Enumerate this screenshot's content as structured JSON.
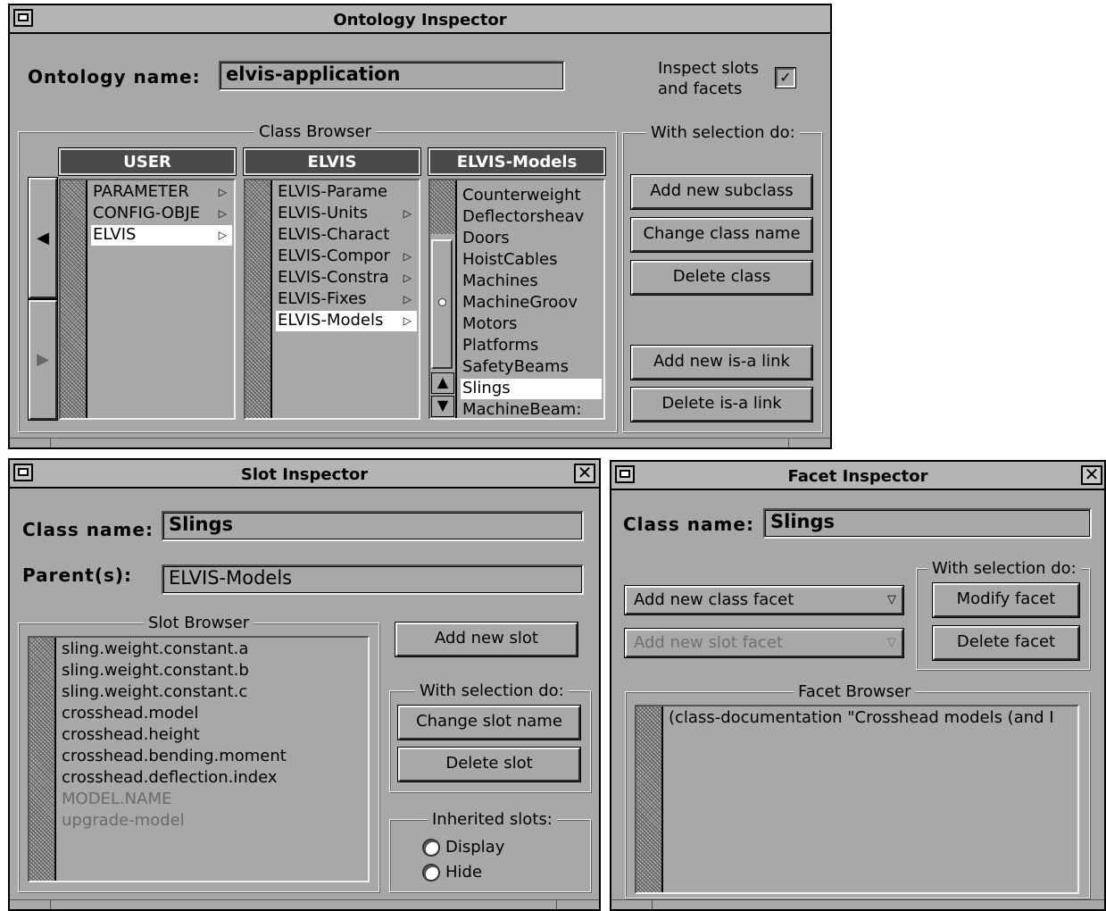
{
  "ontology": {
    "title": "Ontology Inspector",
    "name_label": "Ontology name:",
    "name_value": "elvis-application",
    "inspect_label_line1": "Inspect slots",
    "inspect_label_line2": "and facets",
    "inspect_checked": "✓",
    "class_browser_title": "Class Browser",
    "columns": [
      {
        "header": "USER",
        "items": [
          "PARAMETER",
          "CONFIG-OBJE",
          "ELVIS"
        ],
        "selected": 2
      },
      {
        "header": "ELVIS",
        "items": [
          "ELVIS-Parame",
          "ELVIS-Units",
          "ELVIS-Charact",
          "ELVIS-Compor",
          "ELVIS-Constra",
          "ELVIS-Fixes",
          "ELVIS-Models"
        ],
        "selected": 6
      },
      {
        "header": "ELVIS-Models",
        "items": [
          "Counterweight",
          "Deflectorsheav",
          "Doors",
          "HoistCables",
          "Machines",
          "MachineGroov",
          "Motors",
          "Platforms",
          "SafetyBeams",
          "Slings",
          "MachineBeam:"
        ],
        "selected": 9
      }
    ],
    "arrows": {
      "left": "◀",
      "right": "▶",
      "up": "▲",
      "down": "▼",
      "submenu": "▷"
    },
    "selection_title": "With selection do:",
    "buttons": {
      "add_subclass": "Add new subclass",
      "change_name": "Change class name",
      "delete_class": "Delete class",
      "add_isa": "Add new is-a link",
      "delete_isa": "Delete is-a link"
    }
  },
  "slot": {
    "title": "Slot Inspector",
    "class_label": "Class name:",
    "class_value": "Slings",
    "parent_label": "Parent(s):",
    "parent_value": "ELVIS-Models",
    "browser_title": "Slot Browser",
    "slots": [
      "sling.weight.constant.a",
      "sling.weight.constant.b",
      "sling.weight.constant.c",
      "crosshead.model",
      "crosshead.height",
      "crosshead.bending.moment",
      "crosshead.deflection.index"
    ],
    "inherited": [
      "MODEL.NAME",
      "upgrade-model"
    ],
    "add_slot": "Add new slot",
    "selection_title": "With selection do:",
    "change_slot": "Change slot name",
    "delete_slot": "Delete slot",
    "inherited_title": "Inherited slots:",
    "display": "Display",
    "hide": "Hide",
    "close": "✕"
  },
  "facet": {
    "title": "Facet Inspector",
    "class_label": "Class name:",
    "class_value": "Slings",
    "add_class_facet": "Add new class facet",
    "add_slot_facet": "Add new slot facet",
    "dropdown": "▽",
    "selection_title": "With selection do:",
    "modify": "Modify facet",
    "delete": "Delete facet",
    "browser_title": "Facet Browser",
    "facet_text": "(class-documentation  \"Crosshead models (and I",
    "close": "✕"
  }
}
